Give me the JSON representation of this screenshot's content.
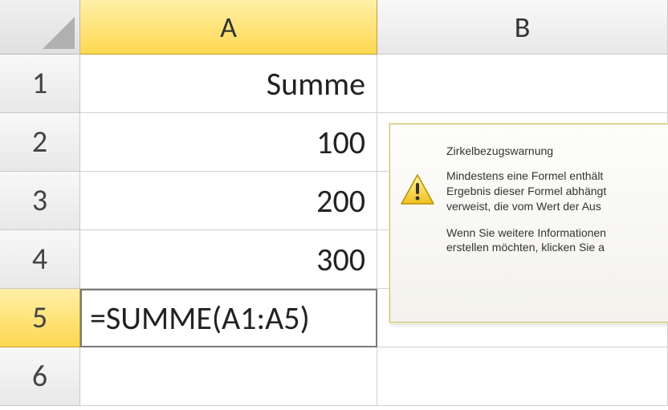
{
  "columns": [
    "A",
    "B"
  ],
  "rows": [
    "1",
    "2",
    "3",
    "4",
    "5",
    "6"
  ],
  "activeRowIndex": 4,
  "cells": {
    "A1": "Summe",
    "A2": "100",
    "A3": "200",
    "A4": "300",
    "A5": "=SUMME(A1:A5)",
    "A6": "",
    "B1": "",
    "B2": "",
    "B3": "",
    "B4": "",
    "B5": "",
    "B6": ""
  },
  "chart_data": {
    "type": "table",
    "columns": [
      "A"
    ],
    "rows": [
      {
        "row": 1,
        "A": "Summe"
      },
      {
        "row": 2,
        "A": 100
      },
      {
        "row": 3,
        "A": 200
      },
      {
        "row": 4,
        "A": 300
      },
      {
        "row": 5,
        "A": "=SUMME(A1:A5)"
      }
    ]
  },
  "tooltip": {
    "title": "Zirkelbezugswarnung",
    "line1": "Mindestens eine Formel enthält",
    "line2": "Ergebnis dieser Formel abhängt",
    "line3": "verweist, die vom Wert der Aus",
    "line4": "Wenn Sie weitere Informationen",
    "line5": "erstellen möchten, klicken Sie a"
  }
}
